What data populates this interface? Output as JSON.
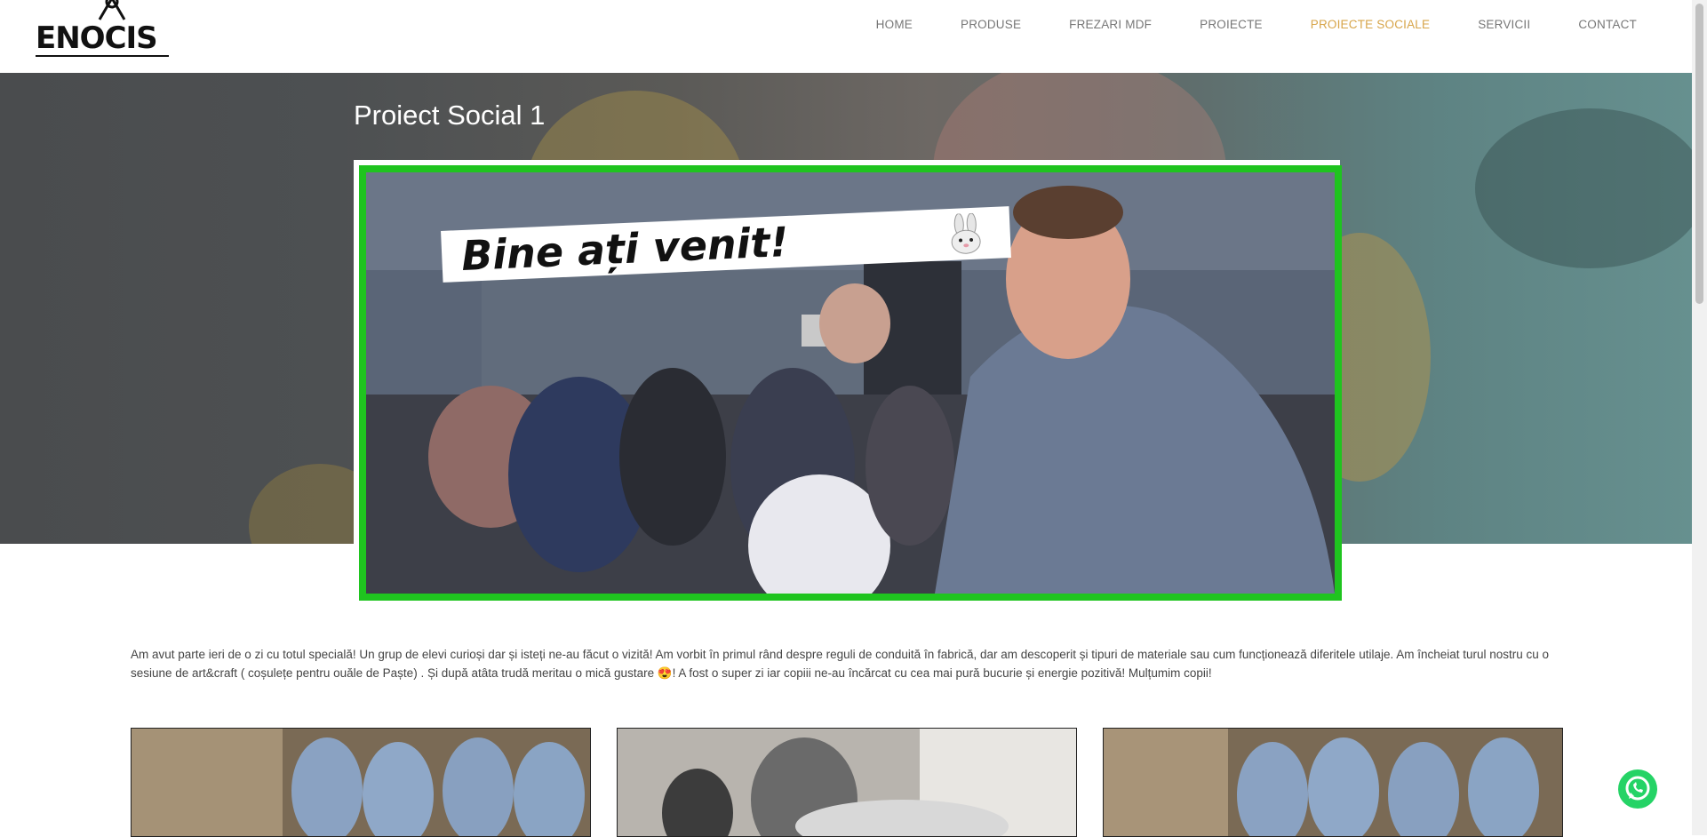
{
  "header": {
    "logo_text": "ENOCIS",
    "nav": [
      {
        "label": "HOME",
        "active": false
      },
      {
        "label": "PRODUSE",
        "active": false
      },
      {
        "label": "FREZARI MDF",
        "active": false
      },
      {
        "label": "PROIECTE",
        "active": false
      },
      {
        "label": "PROIECTE SOCIALE",
        "active": true
      },
      {
        "label": "SERVICII",
        "active": false
      },
      {
        "label": "CONTACT",
        "active": false
      }
    ]
  },
  "hero": {
    "title": "Proiect Social 1"
  },
  "video": {
    "banner_text": "Bine ați venit!",
    "frame_color": "#1fc41f"
  },
  "content": {
    "description": "Am avut parte ieri de o zi cu totul specială! Un grup de elevi curioși dar și isteți ne-au făcut o vizită! Am vorbit în primul rând despre reguli de conduită în fabrică, dar am descoperit și tipuri de materiale sau cum funcționează diferitele utilaje. Am încheiat turul nostru cu o sesiune de art&craft ( coșulețe pentru ouăle de Paște) . Și după atâta trudă meritau o mică gustare 😍! A fost o super zi iar copiii ne-au încărcat cu cea mai pură bucurie și energie pozitivă! Mulțumim copii!"
  },
  "colors": {
    "accent": "#d7a54a",
    "nav_text": "#777777",
    "whatsapp": "#25d366"
  },
  "icons": {
    "whatsapp": "whatsapp-icon",
    "logo": "enocis-logo"
  }
}
